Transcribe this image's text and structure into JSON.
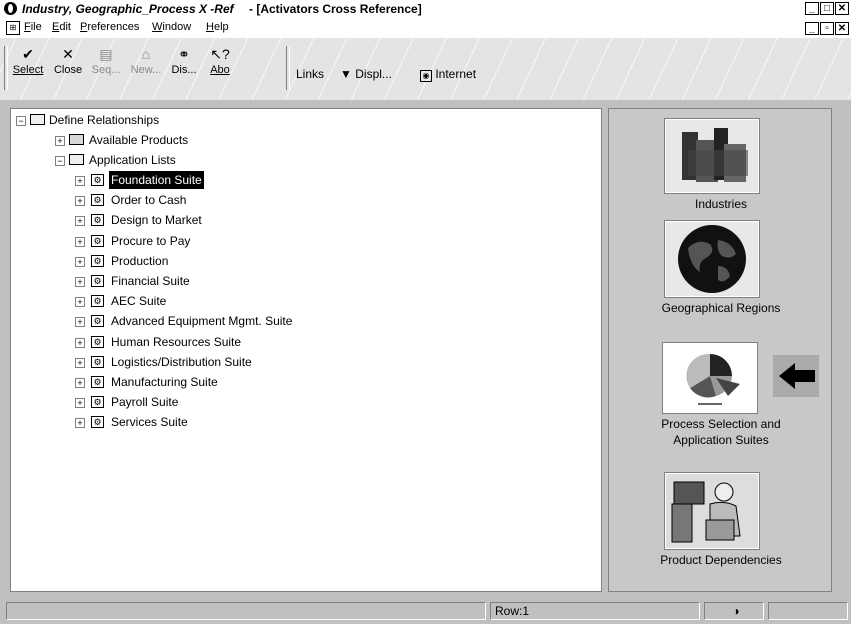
{
  "window": {
    "app_title": "Industry, Geographic_Process X -Ref",
    "doc_title": "- [Activators Cross Reference]"
  },
  "menu": [
    "File",
    "Edit",
    "Preferences",
    "Window",
    "Help"
  ],
  "toolbar": {
    "select": "Select",
    "close": "Close",
    "seq": "Seq...",
    "new": "New...",
    "dis": "Dis...",
    "abo": "Abo",
    "links": "Links",
    "displ": "Displ...",
    "internet": "Internet"
  },
  "tree": {
    "root": "Define Relationships",
    "available_products": "Available Products",
    "application_lists": "Application Lists",
    "items": [
      "Foundation Suite",
      "Order to Cash",
      "Design to Market",
      "Procure to Pay",
      "Production",
      "Financial Suite",
      "AEC Suite",
      "Advanced Equipment Mgmt. Suite",
      "Human Resources Suite",
      "Logistics/Distribution Suite",
      "Manufacturing Suite",
      "Payroll Suite",
      "Services Suite"
    ]
  },
  "nav": {
    "industries": "Industries",
    "geo": "Geographical Regions",
    "process_line1": "Process Selection and",
    "process_line2": "Application Suites",
    "product_dep": "Product Dependencies"
  },
  "status": {
    "row": "Row:1"
  }
}
